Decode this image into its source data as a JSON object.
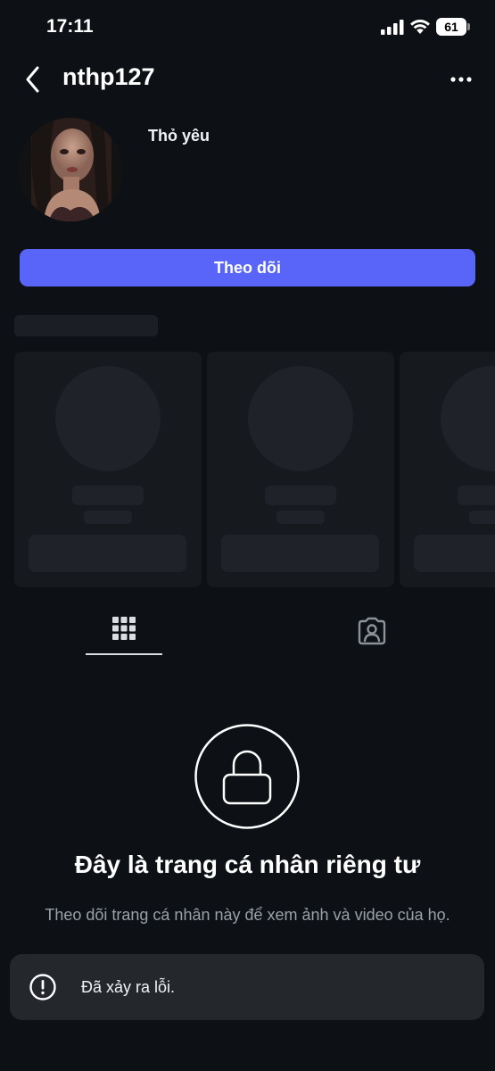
{
  "status_bar": {
    "time": "17:11",
    "battery_level": "61"
  },
  "header": {
    "username": "nthp127",
    "back_icon": "chevron-left-icon",
    "more_icon": "more-horizontal-icon"
  },
  "profile": {
    "display_name": "Thỏ yêu",
    "follow_label": "Theo dõi"
  },
  "tabs": [
    {
      "icon": "grid-icon",
      "active": true
    },
    {
      "icon": "tagged-person-icon",
      "active": false
    }
  ],
  "private_notice": {
    "title": "Đây là trang cá nhân riêng tư",
    "subtitle": "Theo dõi trang cá nhân này để xem ảnh và video của họ."
  },
  "toast": {
    "message": "Đã xảy ra lỗi.",
    "icon": "alert-circle-icon"
  },
  "colors": {
    "background": "#0d1116",
    "accent": "#5865f8",
    "toast_bg": "#24282d"
  }
}
